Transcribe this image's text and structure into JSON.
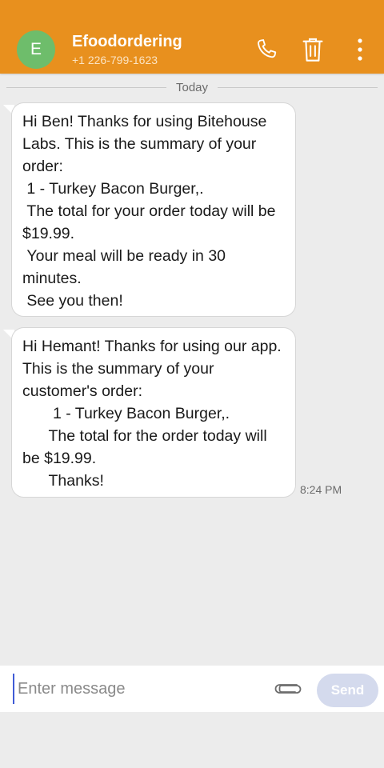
{
  "header": {
    "avatar_letter": "E",
    "contact_name": "Efoodordering",
    "contact_number": "+1 226-799-1623",
    "call_icon": "phone-icon",
    "delete_icon": "trash-icon",
    "more_icon": "more-vert-icon"
  },
  "conversation": {
    "date_label": "Today",
    "messages": [
      {
        "text": "Hi Ben! Thanks for using Bitehouse Labs. This is the summary of your order:\n 1 - Turkey Bacon Burger,.\n The total for your order today will be $19.99.\n Your meal will be ready in 30 minutes.\n See you then!"
      },
      {
        "text": "Hi Hemant! Thanks for using our app. This is the summary of your customer's order:\n       1 - Turkey Bacon Burger,.\n      The total for the order today will be $19.99.\n      Thanks!"
      }
    ],
    "timestamp": "8:24 PM"
  },
  "composer": {
    "placeholder": "Enter message",
    "value": "",
    "attach_icon": "paperclip-icon",
    "send_label": "Send"
  },
  "colors": {
    "appbar": "#e8901e",
    "avatar": "#6ebd6b",
    "send_button_disabled": "#d4daed",
    "background": "#ececec"
  }
}
